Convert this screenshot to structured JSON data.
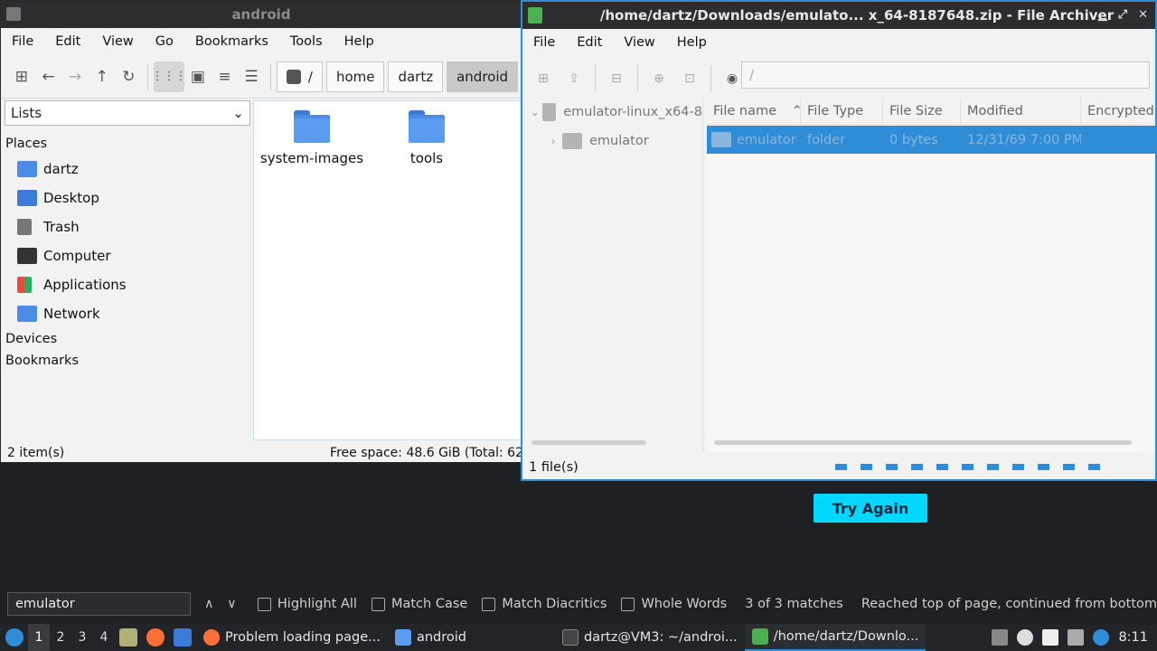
{
  "file_manager": {
    "title": "android",
    "menu": [
      "File",
      "Edit",
      "View",
      "Go",
      "Bookmarks",
      "Tools",
      "Help"
    ],
    "breadcrumbs": [
      "/",
      "home",
      "dartz",
      "android"
    ],
    "side_pane_mode": "Lists",
    "places_header": "Places",
    "places": [
      "dartz",
      "Desktop",
      "Trash",
      "Computer",
      "Applications",
      "Network"
    ],
    "devices_header": "Devices",
    "bookmarks_header": "Bookmarks",
    "files": [
      "system-images",
      "tools"
    ],
    "status_items": "2 item(s)",
    "status_free": "Free space: 48.6 GiB (Total: 62"
  },
  "archiver": {
    "title": "/home/dartz/Downloads/emulato... x_64-8187648.zip - File Archiver",
    "menu": [
      "File",
      "Edit",
      "View",
      "Help"
    ],
    "location": "/",
    "tree_root": "emulator-linux_x64-8",
    "tree_child": "emulator",
    "columns": [
      "File name",
      "File Type",
      "File Size",
      "Modified",
      "Encrypted"
    ],
    "rows": [
      {
        "name": "emulator",
        "type": "folder",
        "size": "0 bytes",
        "modified": "12/31/69 7:00 PM"
      }
    ],
    "status": "1 file(s)"
  },
  "page": {
    "try_again": "Try Again"
  },
  "findbar": {
    "query": "emulator",
    "highlight_all": "Highlight All",
    "match_case": "Match Case",
    "match_diacritics": "Match Diacritics",
    "whole_words": "Whole Words",
    "matches": "3 of 3 matches",
    "status": "Reached top of page, continued from bottom"
  },
  "taskbar": {
    "workspaces": [
      "1",
      "2",
      "3",
      "4"
    ],
    "tasks": [
      "Problem loading page...",
      "android",
      "dartz@VM3: ~/androi...",
      "/home/dartz/Downlo..."
    ],
    "clock": "8:11"
  },
  "colors": {
    "accent": "#2f8cd6",
    "folder": "#5b9cf0",
    "try_again_bg": "#00d8ff",
    "panel_bg": "#1f2023"
  }
}
